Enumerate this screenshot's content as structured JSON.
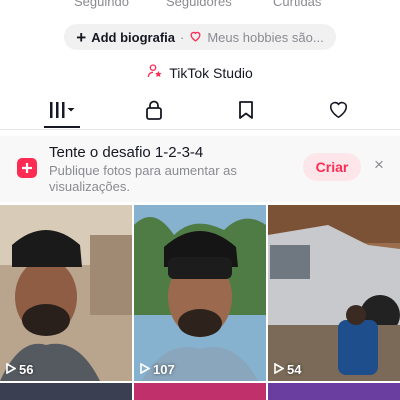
{
  "stats": {
    "labels": [
      "Seguindo",
      "Seguidores",
      "Curtidas"
    ]
  },
  "bio": {
    "plus_icon": "plus-icon",
    "add_label": "Add biografia",
    "separator": "·",
    "heart_icon": "heart-outline-icon",
    "hobbies_text": "Meus hobbies são..."
  },
  "studio": {
    "icon": "person-star-icon",
    "label": "TikTok Studio"
  },
  "tabs": [
    {
      "name": "videos",
      "icon": "grid-bars-icon",
      "active": true
    },
    {
      "name": "private",
      "icon": "lock-icon",
      "active": false
    },
    {
      "name": "favorites",
      "icon": "bookmark-icon",
      "active": false
    },
    {
      "name": "liked",
      "icon": "heart-icon",
      "active": false
    }
  ],
  "challenge": {
    "icon": "photo-plus-icon",
    "title": "Tente o desafio 1-2-3-4",
    "subtitle": "Publique fotos para aumentar as visualizações.",
    "button_label": "Criar",
    "close_label": "×"
  },
  "videos": [
    {
      "views": "56"
    },
    {
      "views": "107"
    },
    {
      "views": "54"
    }
  ],
  "colors": {
    "accent": "#fe2c55",
    "text": "#161823",
    "muted": "#8a8b91",
    "pill_bg": "#f1f1f2"
  }
}
